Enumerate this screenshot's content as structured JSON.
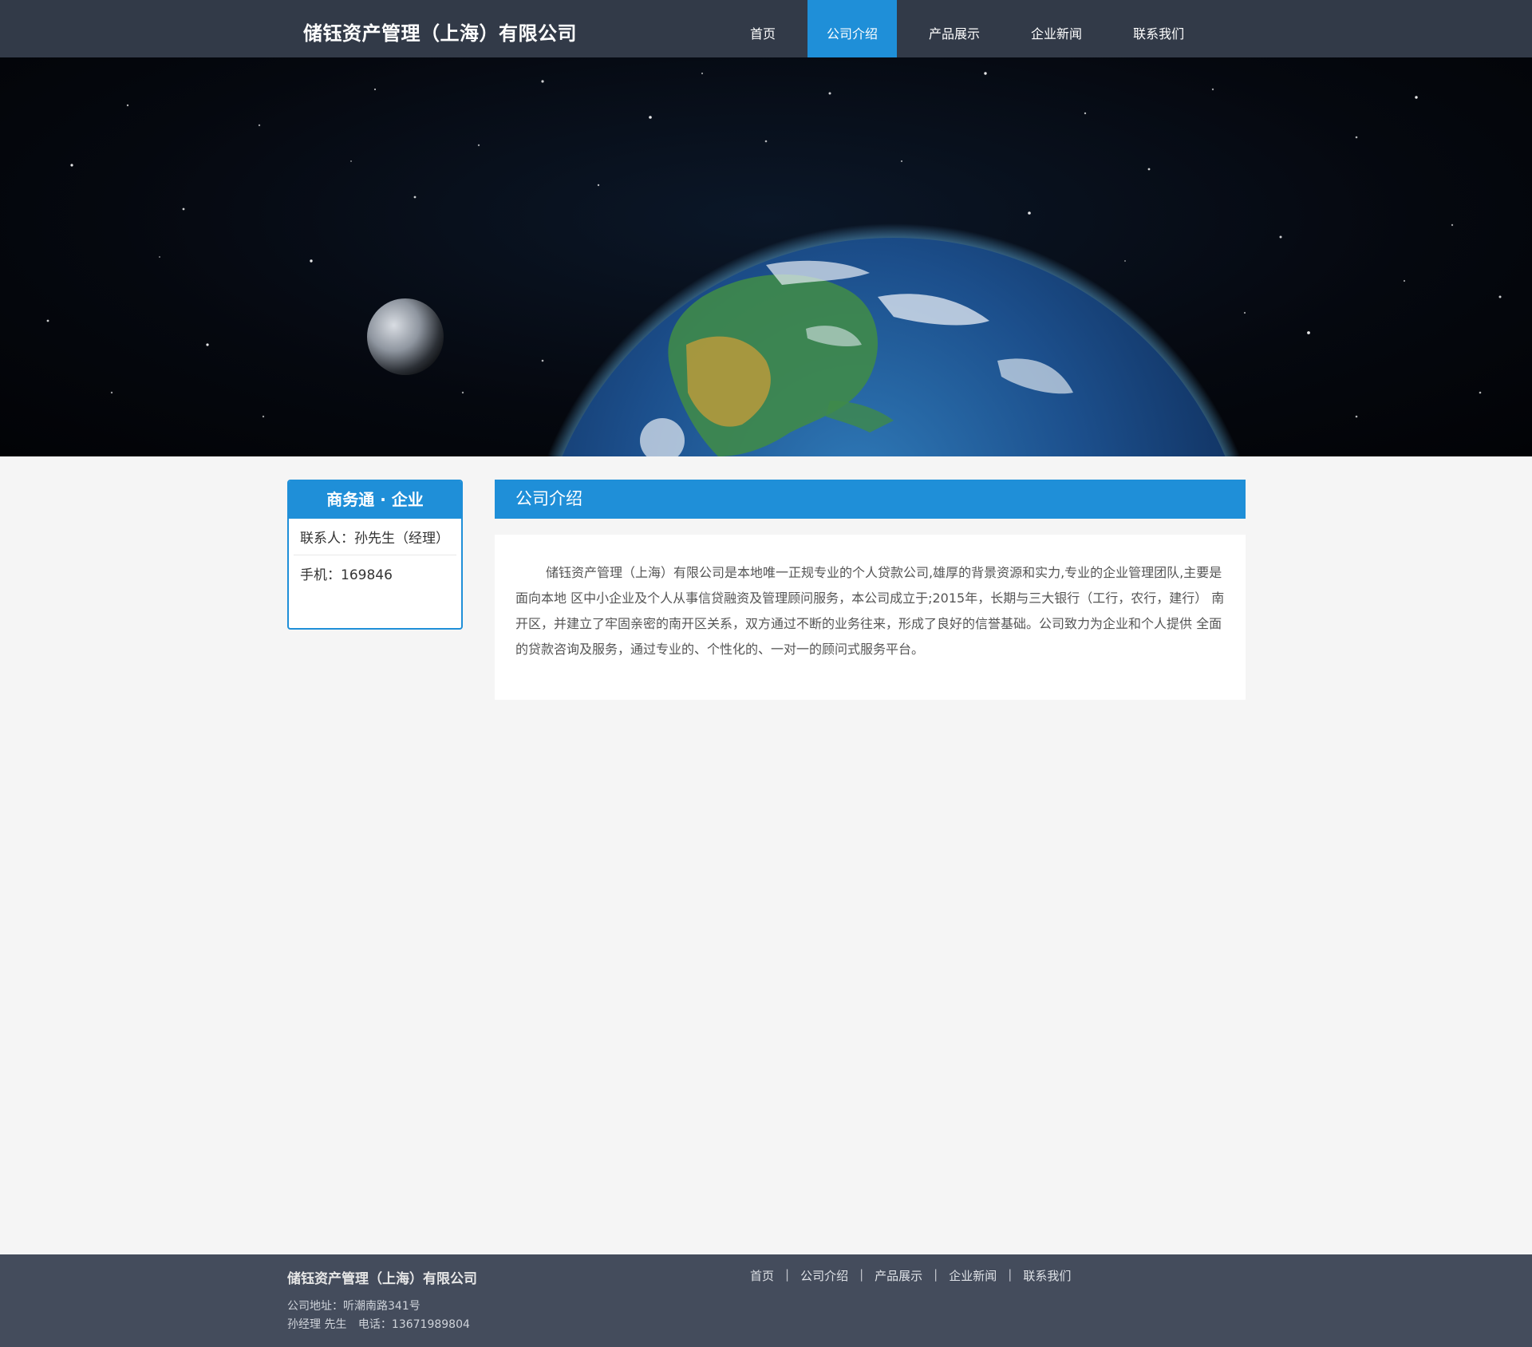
{
  "header": {
    "company_name": "储钰资产管理（上海）有限公司",
    "nav": [
      {
        "label": "首页"
      },
      {
        "label": "公司介绍"
      },
      {
        "label": "产品展示"
      },
      {
        "label": "企业新闻"
      },
      {
        "label": "联系我们"
      }
    ],
    "active_nav_index": 1
  },
  "sidebar": {
    "title": "商务通 · 企业",
    "contact_person": "联系人：孙先生（经理）",
    "mobile": "手机：169846"
  },
  "main": {
    "title": "公司介绍",
    "body": "储钰资产管理（上海）有限公司是本地唯一正规专业的个人贷款公司,雄厚的背景资源和实力,专业的企业管理团队,主要是面向本地 区中小企业及个人从事信贷融资及管理顾问服务，本公司成立于;2015年，长期与三大银行（工行，农行，建行） 南开区，并建立了牢固亲密的南开区关系，双方通过不断的业务往来，形成了良好的信誉基础。公司致力为企业和个人提供 全面的贷款咨询及服务，通过专业的、个性化的、一对一的顾问式服务平台。"
  },
  "footer": {
    "company_name": "储钰资产管理（上海）有限公司",
    "address": "公司地址：听潮南路341号",
    "contact_name": "孙经理 先生",
    "phone": "电话：13671989804",
    "nav": [
      {
        "label": "首页"
      },
      {
        "label": "公司介绍"
      },
      {
        "label": "产品展示"
      },
      {
        "label": "企业新闻"
      },
      {
        "label": "联系我们"
      }
    ],
    "separator": "|"
  },
  "colors": {
    "header_bg": "#323a48",
    "accent": "#1f8fd8",
    "page_bg": "#f5f5f5",
    "footer_bg": "#444c5c"
  }
}
